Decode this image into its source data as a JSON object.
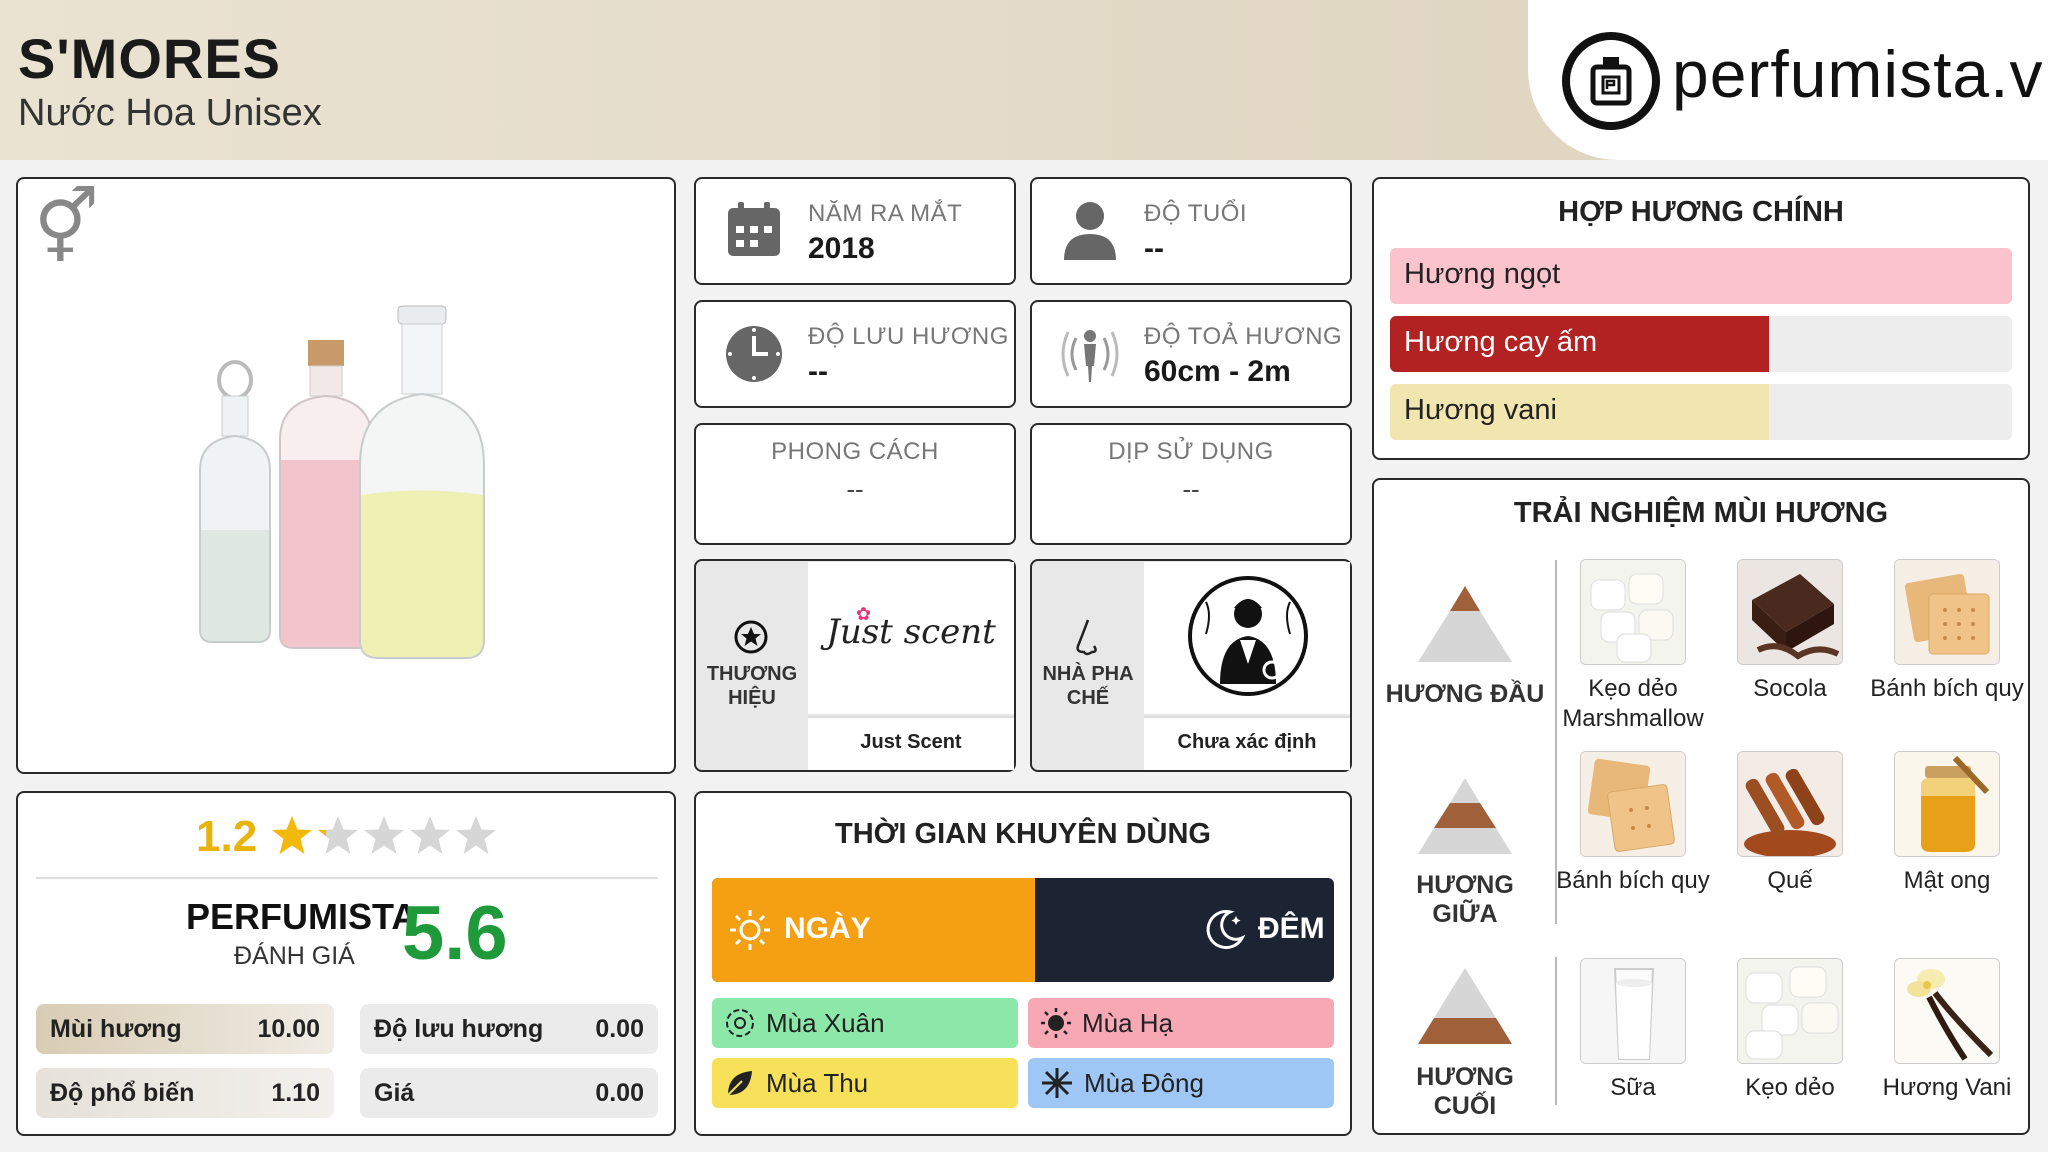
{
  "header": {
    "title": "S'MORES",
    "subtitle": "Nước Hoa Unisex",
    "logo_text": "perfumista.vn"
  },
  "info": {
    "year": {
      "label": "NĂM RA MẮT",
      "value": "2018",
      "icon": "calendar-icon"
    },
    "age": {
      "label": "ĐỘ TUỔI",
      "value": "--",
      "icon": "person-icon"
    },
    "longevity": {
      "label": "ĐỘ LƯU HƯƠNG",
      "value": "--",
      "icon": "clock-icon"
    },
    "sillage": {
      "label": "ĐỘ TOẢ HƯƠNG",
      "value": "60cm - 2m",
      "icon": "sillage-icon"
    },
    "style": {
      "label": "PHONG CÁCH",
      "value": "--"
    },
    "occasion": {
      "label": "DỊP SỬ DỤNG",
      "value": "--"
    },
    "brand": {
      "label": "THƯƠNG HIỆU",
      "name": "Just Scent",
      "logo_text": "Just scent",
      "icon": "star-badge-icon"
    },
    "perfumer": {
      "label": "NHÀ PHA CHẾ",
      "name": "Chưa xác định",
      "icon": "nose-icon"
    }
  },
  "accords": {
    "title": "HỢP HƯƠNG CHÍNH",
    "items": [
      {
        "label": "Hương ngọt",
        "percent": 100,
        "color": "#fbc4cc",
        "text_color": "#222"
      },
      {
        "label": "Hương cay ấm",
        "percent": 61,
        "color": "#b22222",
        "text_color": "#ffffff"
      },
      {
        "label": "Hương vani",
        "percent": 61,
        "color": "#f2e6b0",
        "text_color": "#222"
      }
    ]
  },
  "pyramid": {
    "title": "TRẢI NGHIỆM MÙI HƯƠNG",
    "top": {
      "label": "HƯƠNG ĐẦU",
      "notes": [
        "Kẹo dẻo Marshmallow",
        "Socola",
        "Bánh bích quy"
      ]
    },
    "middle": {
      "label": "HƯƠNG GIỮA",
      "notes": [
        "Bánh bích quy",
        "Quế",
        "Mật ong"
      ]
    },
    "base": {
      "label": "HƯƠNG CUỐI",
      "notes": [
        "Sữa",
        "Kẹo dẻo",
        "Hương Vani"
      ]
    }
  },
  "rating": {
    "score": "1.2",
    "stars_filled": 1.2,
    "stars_total": 5,
    "perfumista_label": "PERFUMISTA",
    "perfumista_sub": "ĐÁNH GIÁ",
    "perfumista_score": "5.6",
    "stats": [
      {
        "label": "Mùi hương",
        "value": "10.00"
      },
      {
        "label": "Độ lưu hương",
        "value": "0.00"
      },
      {
        "label": "Độ phổ biến",
        "value": "1.10"
      },
      {
        "label": "Giá",
        "value": "0.00"
      }
    ]
  },
  "time": {
    "title": "THỜI GIAN KHUYÊN DÙNG",
    "day_label": "NGÀY",
    "night_label": "ĐÊM",
    "day_percent": 52,
    "seasons": [
      {
        "label": "Mùa Xuân",
        "color": "#8ce8a8",
        "icon": "flower-icon"
      },
      {
        "label": "Mùa Hạ",
        "color": "#f8a8b4",
        "icon": "sun-icon"
      },
      {
        "label": "Mùa Thu",
        "color": "#f7e05a",
        "icon": "leaf-icon"
      },
      {
        "label": "Mùa Đông",
        "color": "#9fc7f5",
        "icon": "snowflake-icon"
      }
    ]
  }
}
